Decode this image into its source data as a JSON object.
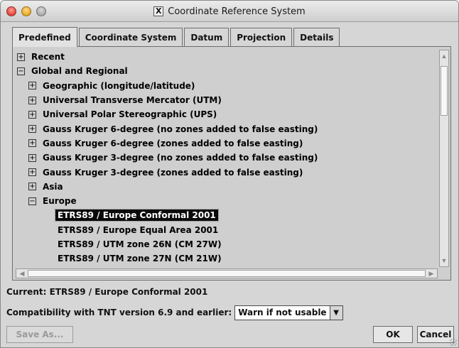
{
  "window": {
    "title": "Coordinate Reference System",
    "title_icon": "X"
  },
  "tabs": [
    {
      "label": "Predefined",
      "active": true
    },
    {
      "label": "Coordinate System",
      "active": false
    },
    {
      "label": "Datum",
      "active": false
    },
    {
      "label": "Projection",
      "active": false
    },
    {
      "label": "Details",
      "active": false
    }
  ],
  "tree": {
    "items": [
      {
        "label": "Recent",
        "level": 0,
        "expander": "⊞",
        "selected": false
      },
      {
        "label": "Global and Regional",
        "level": 0,
        "expander": "⊟",
        "selected": false
      },
      {
        "label": "Geographic (longitude/latitude)",
        "level": 1,
        "expander": "⊞",
        "selected": false
      },
      {
        "label": "Universal Transverse Mercator (UTM)",
        "level": 1,
        "expander": "⊞",
        "selected": false
      },
      {
        "label": "Universal Polar Stereographic (UPS)",
        "level": 1,
        "expander": "⊞",
        "selected": false
      },
      {
        "label": "Gauss Kruger 6-degree (no zones added to false easting)",
        "level": 1,
        "expander": "⊞",
        "selected": false
      },
      {
        "label": "Gauss Kruger 6-degree (zones added to false easting)",
        "level": 1,
        "expander": "⊞",
        "selected": false
      },
      {
        "label": "Gauss Kruger 3-degree (no zones added to false easting)",
        "level": 1,
        "expander": "⊞",
        "selected": false
      },
      {
        "label": "Gauss Kruger 3-degree (zones added to false easting)",
        "level": 1,
        "expander": "⊞",
        "selected": false
      },
      {
        "label": "Asia",
        "level": 1,
        "expander": "⊞",
        "selected": false
      },
      {
        "label": "Europe",
        "level": 1,
        "expander": "⊟",
        "selected": false
      },
      {
        "label": "ETRS89 / Europe Conformal 2001",
        "level": 2,
        "expander": "",
        "selected": true
      },
      {
        "label": "ETRS89 / Europe Equal Area 2001",
        "level": 2,
        "expander": "",
        "selected": false
      },
      {
        "label": "ETRS89 / UTM zone 26N (CM 27W)",
        "level": 2,
        "expander": "",
        "selected": false
      },
      {
        "label": "ETRS89 / UTM zone 27N (CM 21W)",
        "level": 2,
        "expander": "",
        "selected": false
      }
    ]
  },
  "status": {
    "current_text": "Current: ETRS89 / Europe Conformal 2001"
  },
  "compatibility": {
    "label": "Compatibility with TNT version 6.9 and earlier:",
    "selected_option": "Warn if not usable"
  },
  "buttons": {
    "save_as": "Save As...",
    "ok": "OK",
    "cancel": "Cancel"
  },
  "colors": {
    "window_bg": "#d6d6d6",
    "selection_bg": "#0a0a0a",
    "selection_fg": "#ffffff"
  }
}
